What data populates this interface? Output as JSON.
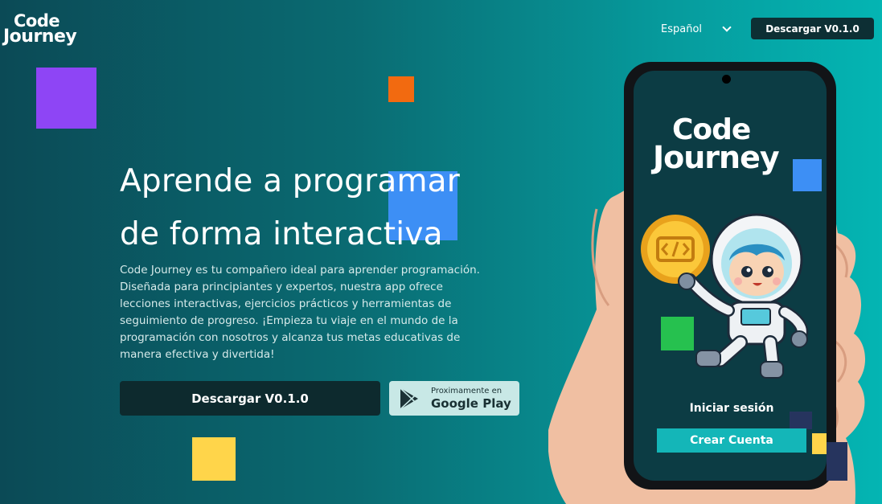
{
  "header": {
    "logo_line1": "Code",
    "logo_line2": "Journey",
    "language": "Español",
    "download_label": "Descargar V0.1.0"
  },
  "hero": {
    "headline_line1": "Aprende a programar",
    "headline_line2": "de forma interactiva",
    "description": "Code Journey es tu compañero ideal para aprender programación. Diseñada para principiantes y expertos, nuestra app ofrece lecciones interactivas, ejercicios prácticos y herramientas de seguimiento de progreso. ¡Empieza tu viaje en el mundo de la programación con nosotros y alcanza tus metas educativas de manera efectiva y divertida!",
    "download_button": "Descargar V0.1.0",
    "google_play_small": "Proximamente en",
    "google_play_big": "Google Play"
  },
  "phone": {
    "logo_line1": "Code",
    "logo_line2": "Journey",
    "login_label": "Iniciar sesión",
    "create_account_label": "Crear Cuenta"
  },
  "colors": {
    "accent_purple": "#8e45f5",
    "accent_orange": "#f26a10",
    "accent_blue": "#3d8ff5",
    "accent_yellow": "#ffd54a",
    "accent_green": "#26c14f",
    "teal_button": "#14b6b8"
  },
  "icons": {
    "language_dropdown": "chevron-down-icon",
    "google_play": "play-store-icon"
  }
}
